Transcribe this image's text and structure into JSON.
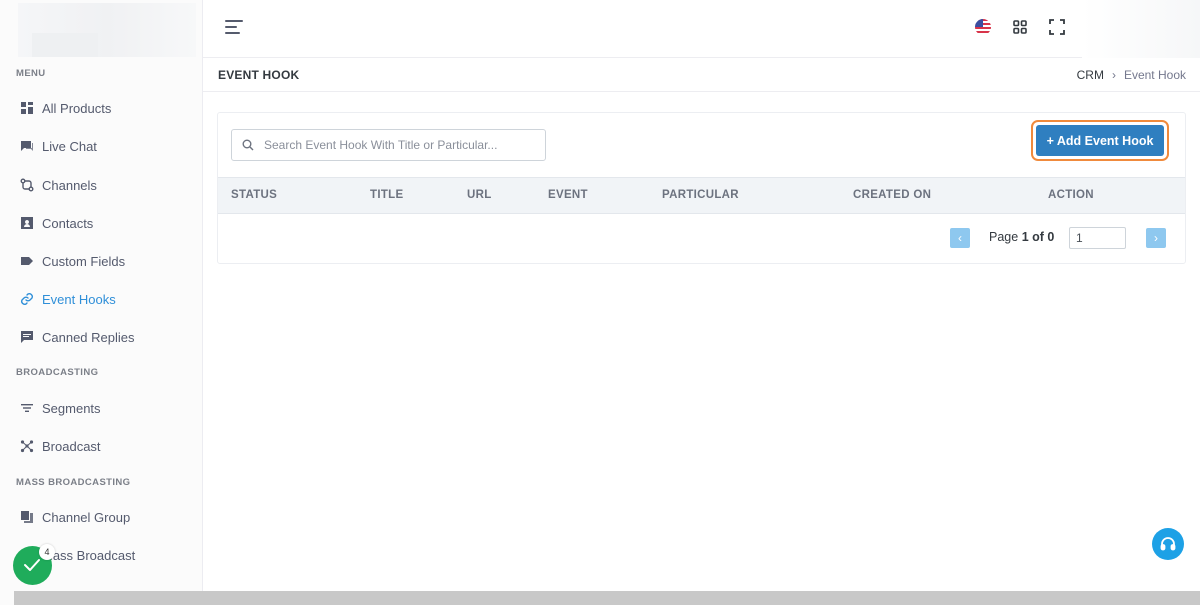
{
  "sidebar": {
    "sections": {
      "menu": "MENU",
      "broadcasting": "BROADCASTING",
      "mass_broadcasting": "MASS BROADCASTING"
    },
    "items": [
      {
        "label": "All Products",
        "icon": "grid-icon"
      },
      {
        "label": "Live Chat",
        "icon": "chat-icon"
      },
      {
        "label": "Channels",
        "icon": "git-compare-icon"
      },
      {
        "label": "Contacts",
        "icon": "contact-card-icon"
      },
      {
        "label": "Custom Fields",
        "icon": "tag-icon"
      },
      {
        "label": "Event Hooks",
        "icon": "link-icon",
        "active": true
      },
      {
        "label": "Canned Replies",
        "icon": "message-square-icon"
      },
      {
        "label": "Segments",
        "icon": "filter-icon"
      },
      {
        "label": "Broadcast",
        "icon": "broadcast-icon"
      },
      {
        "label": "Channel Group",
        "icon": "copy-icon"
      },
      {
        "label": "Mass Broadcast",
        "icon": "broadcast-icon"
      }
    ]
  },
  "header": {
    "language_icon": "us-flag-icon",
    "apps_icon": "apps-grid-icon",
    "fullscreen_icon": "fullscreen-icon"
  },
  "page": {
    "title": "EVENT HOOK",
    "breadcrumb": {
      "root": "CRM",
      "separator": "›",
      "current": "Event Hook"
    }
  },
  "toolbar": {
    "search_placeholder": "Search Event Hook With Title or Particular...",
    "add_label": "+ Add Event Hook"
  },
  "table": {
    "columns": [
      "STATUS",
      "TITLE",
      "URL",
      "EVENT",
      "PARTICULAR",
      "CREATED ON",
      "ACTION"
    ]
  },
  "pagination": {
    "prefix": "Page",
    "current_of": "1 of 0",
    "page_input": "1",
    "prev": "‹",
    "next": "›"
  },
  "floating": {
    "badge_count": "4"
  },
  "colors": {
    "accent": "#2f7fc0",
    "active_nav": "#2f8fd8",
    "highlight": "#f08a3c",
    "status_green": "#1fac5b",
    "help_blue": "#1da1e6"
  }
}
